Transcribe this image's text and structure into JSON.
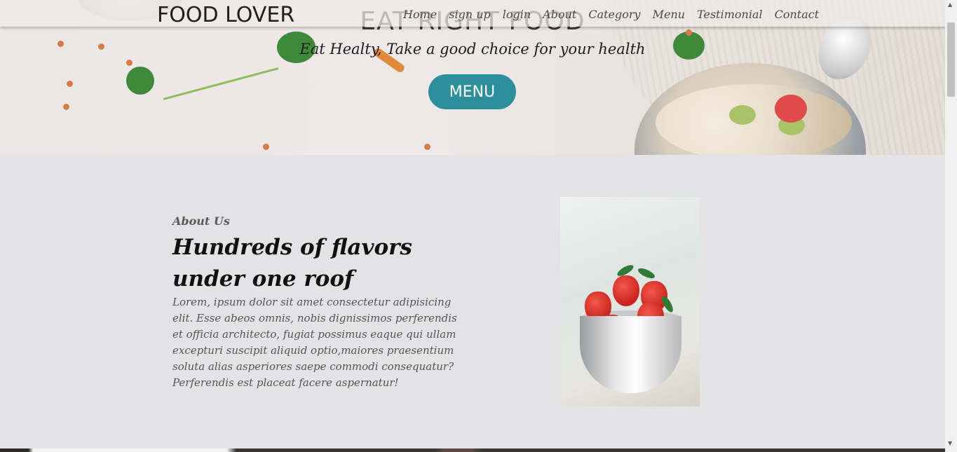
{
  "navbar": {
    "brand": "FOOD LOVER",
    "links": [
      "Home",
      "sign up",
      "login",
      "About",
      "Category",
      "Menu",
      "Testimonial",
      "Contact"
    ]
  },
  "hero": {
    "title": "EAT RIGHT FOOD",
    "subtitle": "Eat Healty, Take a good choice for your health",
    "button_label": "MENU"
  },
  "about": {
    "label": "About Us",
    "heading": "Hundreds of flavors under one roof",
    "text": "Lorem, ipsum dolor sit amet consectetur adipisicing elit. Esse abeos omnis, nobis dignissimos perferendis et officia architecto, fugiat possimus eaque qui ullam excepturi suscipit aliquid optio,maiores praesentium soluta alias asperiores saepe commodi consequatur? Perferendis est placeat facere aspernatur!"
  },
  "colors": {
    "accent": "#2b8f9c",
    "background": "#e3e3e6"
  }
}
